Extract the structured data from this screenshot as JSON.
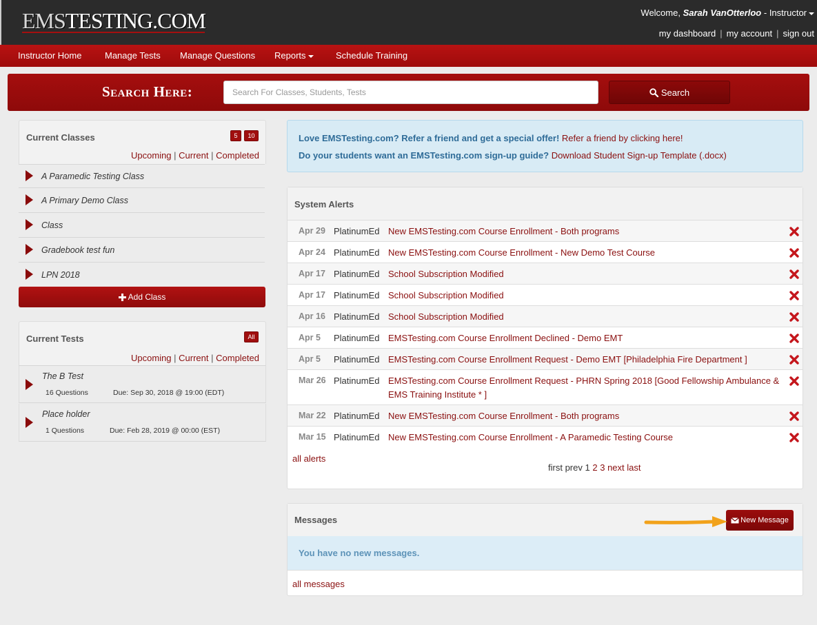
{
  "brand": {
    "logo_ems": "EMS",
    "logo_rest": "TESTING.COM"
  },
  "header": {
    "welcome_prefix": "Welcome,",
    "user_name": "Sarah VanOtterloo",
    "role": "- Instructor",
    "links": [
      "my dashboard",
      "my account",
      "sign out"
    ]
  },
  "nav": {
    "items": [
      "Instructor Home",
      "Manage Tests",
      "Manage Questions",
      "Reports",
      "Schedule Training"
    ]
  },
  "search": {
    "label": "Search Here:",
    "placeholder": "Search For Classes, Students, Tests",
    "button": "Search"
  },
  "classes": {
    "title": "Current Classes",
    "badge_upcoming": "5",
    "badge_total": "10",
    "filters": [
      "Upcoming",
      "Current",
      "Completed"
    ],
    "items": [
      "A Paramedic Testing Class",
      "A Primary Demo Class",
      "Class",
      "Gradebook test fun",
      "LPN 2018"
    ],
    "add_label": "Add Class"
  },
  "tests": {
    "title": "Current Tests",
    "badge": "All",
    "filters": [
      "Upcoming",
      "Current",
      "Completed"
    ],
    "items": [
      {
        "name": "The B Test",
        "questions": "16 Questions",
        "due": "Due: Sep 30, 2018 @ 19:00 (EDT)"
      },
      {
        "name": "Place holder",
        "questions": "1 Questions",
        "due": "Due: Feb 28, 2019 @ 00:00 (EST)"
      }
    ]
  },
  "info": {
    "line1_bold": "Love EMSTesting.com? Refer a friend and get a special offer!",
    "line1_link": "Refer a friend by clicking here!",
    "line2_bold": "Do your students want an EMSTesting.com sign-up guide?",
    "line2_link": "Download Student Sign-up Template (.docx)"
  },
  "alerts": {
    "title": "System Alerts",
    "rows": [
      {
        "date": "Apr 29",
        "source": "PlatinumEd",
        "message": "New EMSTesting.com Course Enrollment - Both programs"
      },
      {
        "date": "Apr 24",
        "source": "PlatinumEd",
        "message": "New EMSTesting.com Course Enrollment - New Demo Test Course"
      },
      {
        "date": "Apr 17",
        "source": "PlatinumEd",
        "message": "School Subscription Modified"
      },
      {
        "date": "Apr 17",
        "source": "PlatinumEd",
        "message": "School Subscription Modified"
      },
      {
        "date": "Apr 16",
        "source": "PlatinumEd",
        "message": "School Subscription Modified"
      },
      {
        "date": "Apr 5",
        "source": "PlatinumEd",
        "message": "EMSTesting.com Course Enrollment Declined - Demo EMT"
      },
      {
        "date": "Apr 5",
        "source": "PlatinumEd",
        "message": "EMSTesting.com Course Enrollment Request - Demo EMT [Philadelphia Fire Department ]"
      },
      {
        "date": "Mar 26",
        "source": "PlatinumEd",
        "message": "EMSTesting.com Course Enrollment Request - PHRN Spring 2018 [Good Fellowship Ambulance & EMS Training Institute * ]"
      },
      {
        "date": "Mar 22",
        "source": "PlatinumEd",
        "message": "New EMSTesting.com Course Enrollment - Both programs"
      },
      {
        "date": "Mar 15",
        "source": "PlatinumEd",
        "message": "New EMSTesting.com Course Enrollment - A Paramedic Testing Course"
      }
    ],
    "all_link": "all alerts",
    "pager": {
      "first": "first",
      "prev": "prev",
      "pages": [
        "1",
        "2",
        "3"
      ],
      "next": "next",
      "last": "last"
    }
  },
  "messages": {
    "title": "Messages",
    "new_button": "New Message",
    "empty": "You have no new messages.",
    "all_link": "all messages"
  },
  "colors": {
    "brand_red": "#a00f0f",
    "nav_red": "#b30f0f",
    "link": "#8a0f0f",
    "info_bg": "#d8ebf5",
    "arrow": "#f2a21b"
  }
}
